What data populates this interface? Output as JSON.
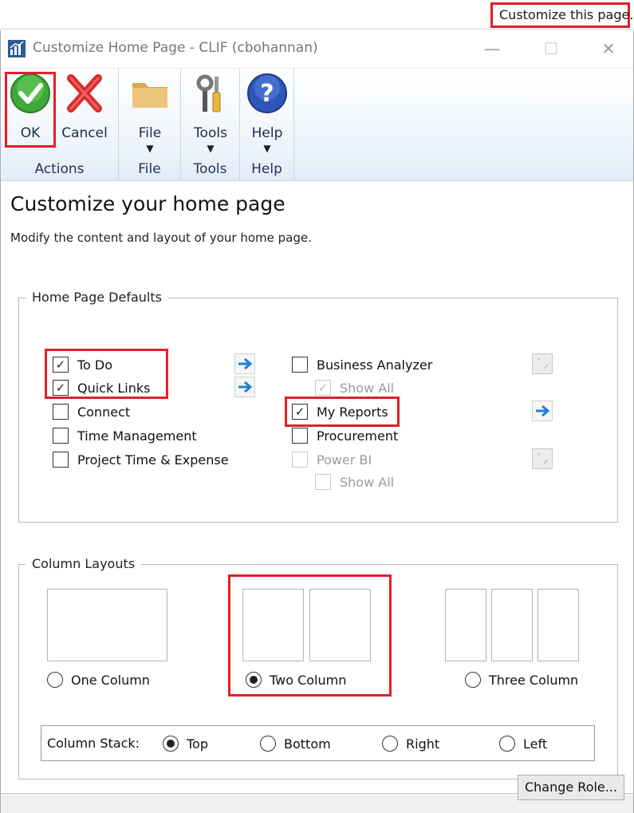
{
  "topbar": {
    "customize_link": "Customize this page."
  },
  "window": {
    "title": "Customize Home Page  -  CLIF (cbohannan)",
    "minimize": "—",
    "maximize": "☐",
    "close": "✕"
  },
  "ribbon": {
    "groups": [
      {
        "label": "Actions",
        "buttons": [
          {
            "label": "OK",
            "icon": "checkmark-icon"
          },
          {
            "label": "Cancel",
            "icon": "red-x-icon"
          }
        ]
      },
      {
        "label": "File",
        "buttons": [
          {
            "label": "File",
            "icon": "folder-icon"
          }
        ]
      },
      {
        "label": "Tools",
        "buttons": [
          {
            "label": "Tools",
            "icon": "tools-icon"
          }
        ]
      },
      {
        "label": "Help",
        "buttons": [
          {
            "label": "Help",
            "icon": "help-icon"
          }
        ]
      }
    ],
    "dropdown_arrow": "▼"
  },
  "page": {
    "title": "Customize your home page",
    "subtitle": "Modify the content and layout of your home page."
  },
  "defaults": {
    "legend": "Home Page Defaults",
    "left": [
      {
        "label": "To Do",
        "checked": true
      },
      {
        "label": "Quick Links",
        "checked": true
      },
      {
        "label": "Connect",
        "checked": false
      },
      {
        "label": "Time Management",
        "checked": false
      },
      {
        "label": "Project Time & Expense",
        "checked": false
      }
    ],
    "right": [
      {
        "label": "Business Analyzer",
        "checked": false,
        "disabled": false
      },
      {
        "label": "Show All",
        "checked": true,
        "disabled": true
      },
      {
        "label": "My Reports",
        "checked": true,
        "disabled": false
      },
      {
        "label": "Procurement",
        "checked": false,
        "disabled": false
      },
      {
        "label": "Power BI",
        "checked": false,
        "disabled": true
      },
      {
        "label": "Show All",
        "checked": false,
        "disabled": true
      }
    ],
    "check_glyph": "✓"
  },
  "layouts": {
    "legend": "Column Layouts",
    "options": [
      {
        "label": "One Column",
        "selected": false
      },
      {
        "label": "Two Column",
        "selected": true
      },
      {
        "label": "Three Column",
        "selected": false
      }
    ],
    "stack": {
      "label": "Column Stack:",
      "options": [
        {
          "label": "Top",
          "selected": true
        },
        {
          "label": "Bottom",
          "selected": false
        },
        {
          "label": "Right",
          "selected": false
        },
        {
          "label": "Left",
          "selected": false
        }
      ]
    }
  },
  "footer": {
    "change_role": "Change Role..."
  },
  "colors": {
    "highlight": "#e0202a",
    "ribbon_text": "#1d2c4a",
    "arrow_blue": "#1f7fd6"
  }
}
